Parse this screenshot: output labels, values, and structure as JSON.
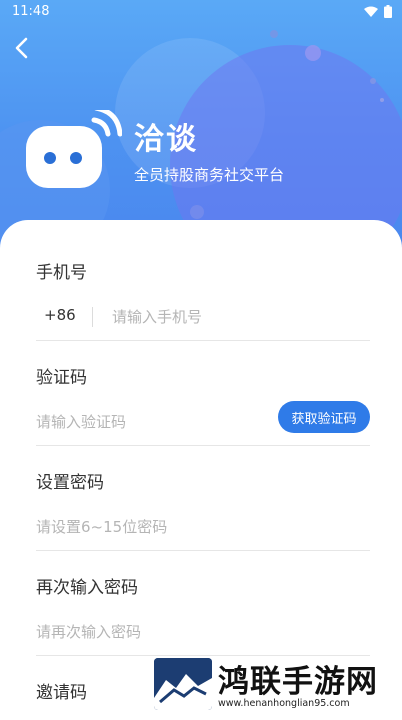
{
  "status": {
    "time": "11:48"
  },
  "app": {
    "name": "洽谈",
    "tagline": "全员持股商务社交平台"
  },
  "form": {
    "phone": {
      "label": "手机号",
      "prefix": "+86",
      "placeholder": "请输入手机号"
    },
    "code": {
      "label": "验证码",
      "placeholder": "请输入验证码",
      "button": "获取验证码"
    },
    "password": {
      "label": "设置密码",
      "placeholder": "请设置6~15位密码"
    },
    "confirm": {
      "label": "再次输入密码",
      "placeholder": "请再次输入密码"
    },
    "invite": {
      "label": "邀请码"
    }
  },
  "watermark": {
    "title": "鸿联手游网",
    "url": "www.henanhonglian95.com"
  },
  "colors": {
    "accent": "#2f7be8",
    "hero_top": "#5aa9f6",
    "hero_bottom": "#4a86ee"
  }
}
